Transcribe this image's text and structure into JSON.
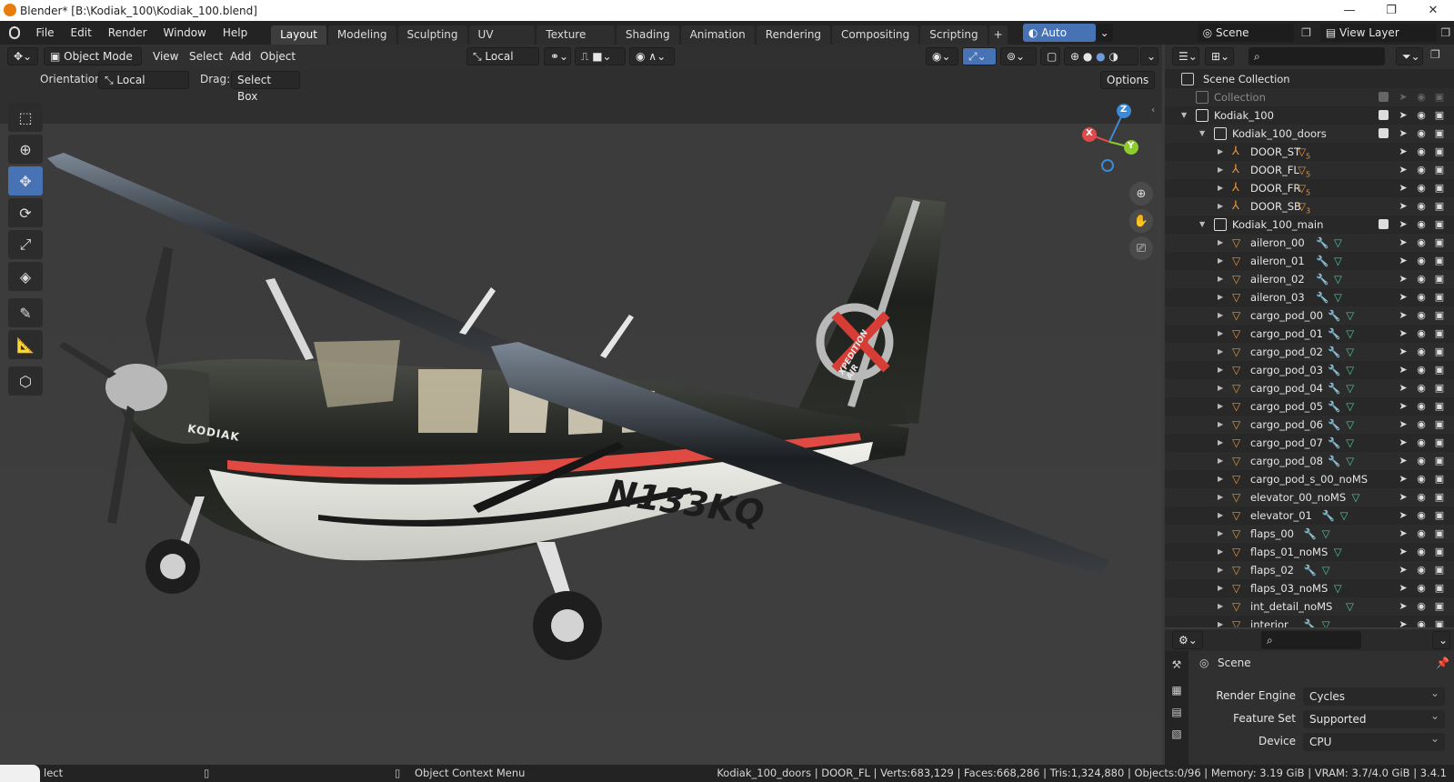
{
  "window": {
    "title": "Blender* [B:\\Kodiak_100\\Kodiak_100.blend]",
    "minimize": "—",
    "maximize": "❐",
    "close": "✕"
  },
  "menu": {
    "items": [
      "File",
      "Edit",
      "Render",
      "Window",
      "Help"
    ],
    "workspaces": [
      "Layout",
      "Modeling",
      "Sculpting",
      "UV Editing",
      "Texture Paint",
      "Shading",
      "Animation",
      "Rendering",
      "Compositing",
      "Scripting"
    ],
    "active_workspace": "Layout",
    "add_tab": "+",
    "auto_save": "Auto Save",
    "scene": "Scene",
    "view_layer": "View Layer"
  },
  "viewport_header": {
    "mode": "Object Mode",
    "menus": [
      "View",
      "Select",
      "Add",
      "Object"
    ],
    "transform_orientation": "Local",
    "orientation_label": "Orientation:",
    "orientation_value": "Local",
    "drag_label": "Drag:",
    "drag_value": "Select Box",
    "options": "Options"
  },
  "gizmo": {
    "x": "X",
    "y": "Y",
    "z": "Z"
  },
  "aircraft": {
    "registration": "N133KQ",
    "brand": "KODIAK",
    "tail": "XPEDITION AIR"
  },
  "outliner": {
    "search_placeholder": "",
    "scene_collection": "Scene Collection",
    "rows": [
      {
        "name": "Collection",
        "kind": "collection",
        "depth": 1,
        "dim": true
      },
      {
        "name": "Kodiak_100",
        "kind": "collection",
        "depth": 1,
        "expanded": true
      },
      {
        "name": "Kodiak_100_doors",
        "kind": "collection",
        "depth": 2,
        "expanded": true
      },
      {
        "name": "DOOR_ST",
        "kind": "armature",
        "depth": 3,
        "badge": "5"
      },
      {
        "name": "DOOR_FL",
        "kind": "armature",
        "depth": 3,
        "badge": "5"
      },
      {
        "name": "DOOR_FR",
        "kind": "armature",
        "depth": 3,
        "badge": "5"
      },
      {
        "name": "DOOR_SB",
        "kind": "armature",
        "depth": 3,
        "badge": "3"
      },
      {
        "name": "Kodiak_100_main",
        "kind": "collection",
        "depth": 2,
        "expanded": true
      },
      {
        "name": "aileron_00",
        "kind": "mesh",
        "depth": 3,
        "mod": true
      },
      {
        "name": "aileron_01",
        "kind": "mesh",
        "depth": 3,
        "mod": true
      },
      {
        "name": "aileron_02",
        "kind": "mesh",
        "depth": 3,
        "mod": true
      },
      {
        "name": "aileron_03",
        "kind": "mesh",
        "depth": 3,
        "mod": true
      },
      {
        "name": "cargo_pod_00",
        "kind": "mesh",
        "depth": 3,
        "mod": true
      },
      {
        "name": "cargo_pod_01",
        "kind": "mesh",
        "depth": 3,
        "mod": true
      },
      {
        "name": "cargo_pod_02",
        "kind": "mesh",
        "depth": 3,
        "mod": true
      },
      {
        "name": "cargo_pod_03",
        "kind": "mesh",
        "depth": 3,
        "mod": true
      },
      {
        "name": "cargo_pod_04",
        "kind": "mesh",
        "depth": 3,
        "mod": true
      },
      {
        "name": "cargo_pod_05",
        "kind": "mesh",
        "depth": 3,
        "mod": true
      },
      {
        "name": "cargo_pod_06",
        "kind": "mesh",
        "depth": 3,
        "mod": true
      },
      {
        "name": "cargo_pod_07",
        "kind": "mesh",
        "depth": 3,
        "mod": true
      },
      {
        "name": "cargo_pod_08",
        "kind": "mesh",
        "depth": 3,
        "mod": true
      },
      {
        "name": "cargo_pod_s_00_noMS",
        "kind": "mesh",
        "depth": 3,
        "mod": false
      },
      {
        "name": "elevator_00_noMS",
        "kind": "mesh",
        "depth": 3,
        "mod": false,
        "data_only": true
      },
      {
        "name": "elevator_01",
        "kind": "mesh",
        "depth": 3,
        "mod": true
      },
      {
        "name": "flaps_00",
        "kind": "mesh",
        "depth": 3,
        "mod": true
      },
      {
        "name": "flaps_01_noMS",
        "kind": "mesh",
        "depth": 3,
        "mod": false,
        "data_only": true
      },
      {
        "name": "flaps_02",
        "kind": "mesh",
        "depth": 3,
        "mod": true
      },
      {
        "name": "flaps_03_noMS",
        "kind": "mesh",
        "depth": 3,
        "mod": false,
        "data_only": true
      },
      {
        "name": "int_detail_noMS",
        "kind": "mesh",
        "depth": 3,
        "mod": false,
        "data_only": true
      },
      {
        "name": "interior",
        "kind": "mesh",
        "depth": 3,
        "mod": true
      }
    ]
  },
  "properties": {
    "context": "Scene",
    "render_engine_label": "Render Engine",
    "render_engine": "Cycles",
    "feature_set_label": "Feature Set",
    "feature_set": "Supported",
    "device_label": "Device",
    "device": "CPU"
  },
  "status": {
    "left": "lect",
    "middle": "Object Context Menu",
    "right": "Kodiak_100_doors | DOOR_FL | Verts:683,129 | Faces:668,286 | Tris:1,324,880 | Objects:0/96 | Memory: 3.19 GiB | VRAM: 3.7/4.0 GiB | 3.4.1"
  },
  "colors": {
    "accent": "#4772b3",
    "mesh_icon": "#e8943a",
    "mod_icon": "#6d9bd8",
    "data_icon": "#4fc7a0",
    "axis_x": "#e24a4a",
    "axis_y": "#8ccd2c",
    "axis_z": "#3b8bd8"
  }
}
